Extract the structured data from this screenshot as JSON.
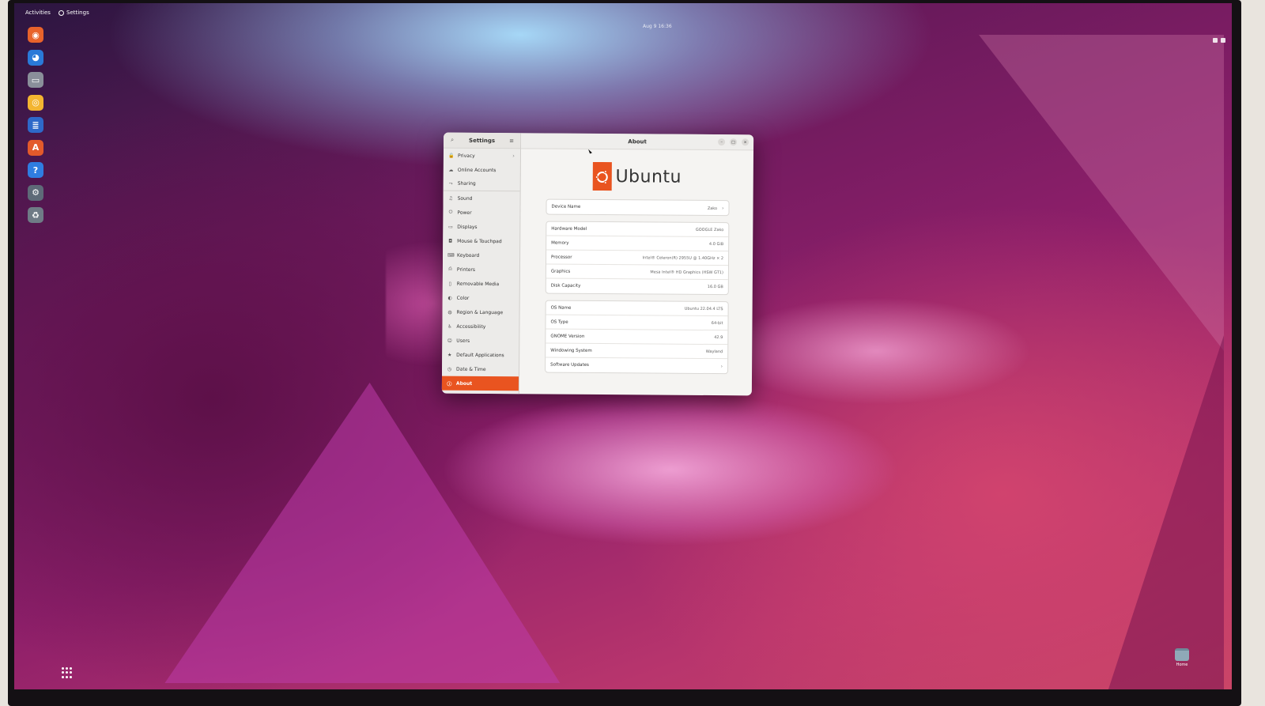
{
  "topbar": {
    "activities": "Activities",
    "app_menu": "Settings",
    "clock": "Aug 9  16:36"
  },
  "dock": {
    "items": [
      "firefox-icon",
      "thunderbird-icon",
      "files-icon",
      "rhythmbox-icon",
      "writer-icon",
      "software-icon",
      "help-icon",
      "settings-icon",
      "trash-icon"
    ],
    "colors": [
      "#e8632b",
      "#2a7ad8",
      "#8a8f9a",
      "#f3b531",
      "#2e69c9",
      "#e35a2b",
      "#2f7de1",
      "#5e6a78",
      "#6f7b86"
    ]
  },
  "desktop": {
    "home_label": "Home"
  },
  "settings": {
    "sidebar_title": "Settings",
    "items": [
      {
        "label": "Privacy",
        "icon": "lock-icon",
        "arrow": "›"
      },
      {
        "label": "Online Accounts",
        "icon": "cloud-icon"
      },
      {
        "label": "Sharing",
        "icon": "share-icon"
      },
      {
        "label": "Sound",
        "icon": "music-icon"
      },
      {
        "label": "Power",
        "icon": "power-icon"
      },
      {
        "label": "Displays",
        "icon": "display-icon"
      },
      {
        "label": "Mouse & Touchpad",
        "icon": "mouse-icon"
      },
      {
        "label": "Keyboard",
        "icon": "keyboard-icon"
      },
      {
        "label": "Printers",
        "icon": "printer-icon"
      },
      {
        "label": "Removable Media",
        "icon": "media-icon"
      },
      {
        "label": "Color",
        "icon": "color-icon"
      },
      {
        "label": "Region & Language",
        "icon": "globe-icon"
      },
      {
        "label": "Accessibility",
        "icon": "accessibility-icon"
      },
      {
        "label": "Users",
        "icon": "users-icon"
      },
      {
        "label": "Default Applications",
        "icon": "star-icon"
      },
      {
        "label": "Date & Time",
        "icon": "clock-icon"
      },
      {
        "label": "About",
        "icon": "info-icon"
      }
    ],
    "about": {
      "title": "About",
      "logo_text": "Ubuntu",
      "device_name_label": "Device Name",
      "device_name_value": "Zako",
      "hardware": [
        {
          "label": "Hardware Model",
          "value": "GOOGLE Zako"
        },
        {
          "label": "Memory",
          "value": "4.0 GiB"
        },
        {
          "label": "Processor",
          "value": "Intel® Celeron(R) 2955U @ 1.40GHz × 2"
        },
        {
          "label": "Graphics",
          "value": "Mesa Intel® HD Graphics (HSW GT1)"
        },
        {
          "label": "Disk Capacity",
          "value": "16.0 GB"
        }
      ],
      "os": [
        {
          "label": "OS Name",
          "value": "Ubuntu 22.04.4 LTS"
        },
        {
          "label": "OS Type",
          "value": "64-bit"
        },
        {
          "label": "GNOME Version",
          "value": "42.9"
        },
        {
          "label": "Windowing System",
          "value": "Wayland"
        },
        {
          "label": "Software Updates",
          "value": "",
          "chevron": "›"
        }
      ]
    }
  }
}
